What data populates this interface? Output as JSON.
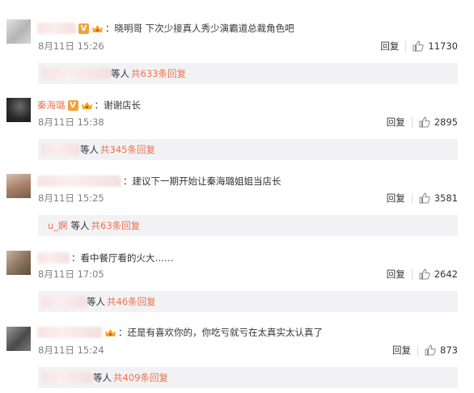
{
  "comments": [
    {
      "username": "",
      "has_v": true,
      "has_vip": true,
      "text": "：晓明哥 下次少接真人秀少演霸道总裁角色吧",
      "time": "8月11日 15:26",
      "reply_label": "回复",
      "likes": "11730",
      "replies": {
        "user": "",
        "suffix": "等人",
        "count_text": "共633条回复"
      },
      "avatar_color": "#c9c9c9"
    },
    {
      "username": "秦海璐",
      "has_v": true,
      "has_vip": true,
      "text": "：谢谢店长",
      "time": "8月11日 15:38",
      "reply_label": "回复",
      "likes": "2895",
      "replies": {
        "user": "",
        "suffix": "等人",
        "count_text": "共345条回复"
      },
      "avatar_color": "#3a3a3a"
    },
    {
      "username": "",
      "has_v": false,
      "has_vip": false,
      "text": "：建议下一期开始让秦海璐姐姐当店长",
      "time": "8月11日 15:25",
      "reply_label": "回复",
      "likes": "3581",
      "replies": {
        "user": "u_婀",
        "suffix": "等人",
        "count_text": "共63条回复"
      },
      "avatar_color": "#b89a86"
    },
    {
      "username": "",
      "has_v": false,
      "has_vip": false,
      "text": "：看中餐厅看的火大……",
      "time": "8月11日 17:05",
      "reply_label": "回复",
      "likes": "2642",
      "replies": {
        "user": "",
        "suffix": "等人",
        "count_text": "共46条回复"
      },
      "avatar_color": "#8f7d6a"
    },
    {
      "username": "",
      "has_v": false,
      "has_vip": true,
      "text": "：还是有喜欢你的，你吃亏就亏在太真实太认真了",
      "time": "8月11日 15:24",
      "reply_label": "回复",
      "likes": "873",
      "replies": {
        "user": "",
        "suffix": "等人",
        "count_text": "共409条回复"
      },
      "avatar_color": "#6e6e6e"
    }
  ],
  "icons": {
    "like": "thumbs-up-icon",
    "verified": "v-badge-icon",
    "vip": "vip-crown-icon"
  },
  "colors": {
    "accent": "#eb7350",
    "replies_bg": "#f2f2f5",
    "time": "#808080"
  }
}
